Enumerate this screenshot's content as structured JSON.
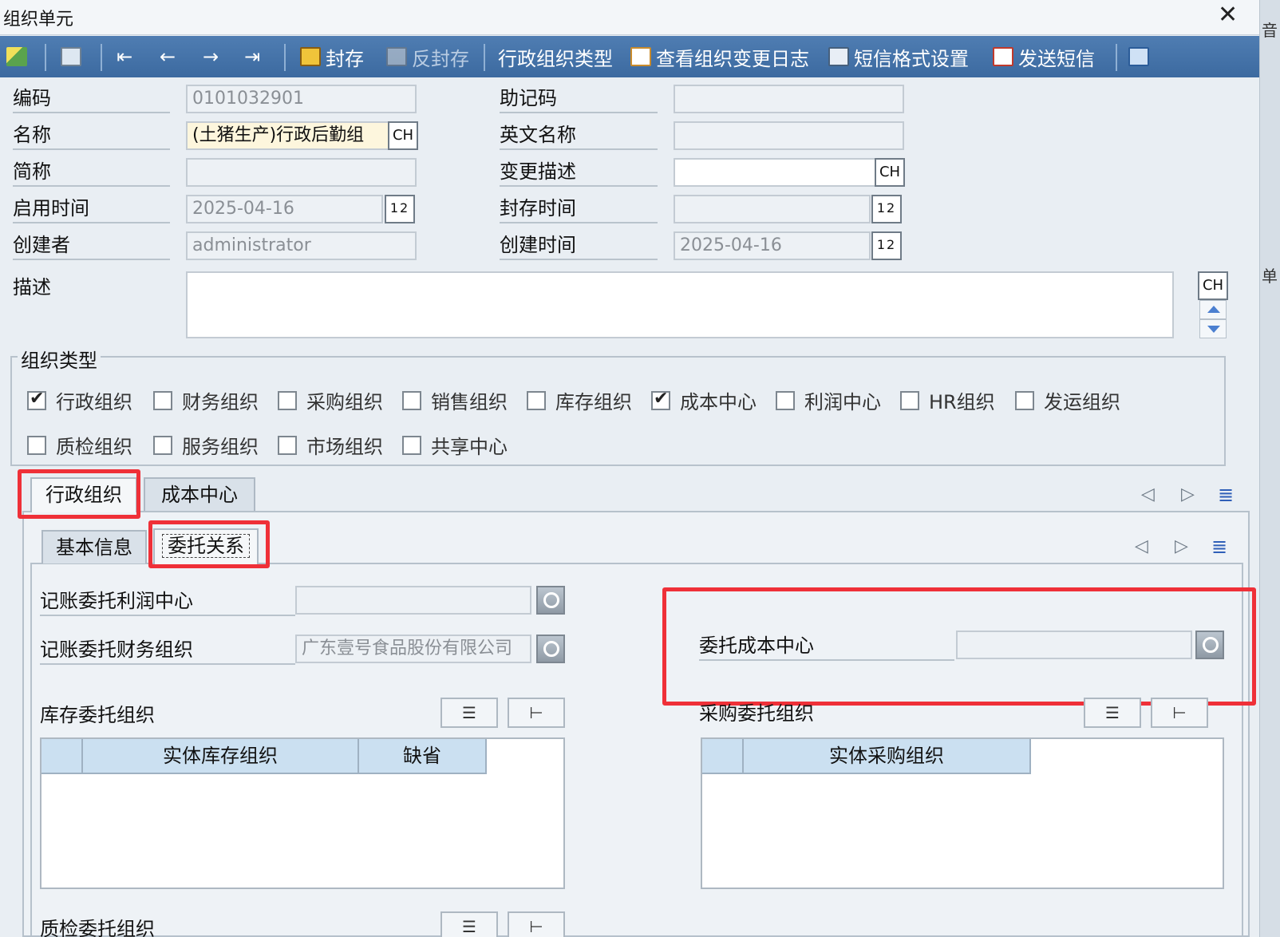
{
  "window": {
    "title": "组织单元",
    "close_label": "✕"
  },
  "right_fragments": {
    "top": "音",
    "mid": "单"
  },
  "toolbar": {
    "seal": "封存",
    "unseal": "反封存",
    "admin_org_type": "行政组织类型",
    "view_change_log": "查看组织变更日志",
    "sms_format": "短信格式设置",
    "send_sms": "发送短信"
  },
  "form": {
    "code": {
      "label": "编码",
      "value": "0101032901"
    },
    "mnemonic": {
      "label": "助记码",
      "value": ""
    },
    "name": {
      "label": "名称",
      "value": "(土猪生产)行政后勤组"
    },
    "english_name": {
      "label": "英文名称",
      "value": ""
    },
    "short_name": {
      "label": "简称",
      "value": ""
    },
    "change_desc": {
      "label": "变更描述",
      "value": ""
    },
    "enable_time": {
      "label": "启用时间",
      "value": "2025-04-16"
    },
    "seal_time": {
      "label": "封存时间",
      "value": ""
    },
    "creator": {
      "label": "创建者",
      "value": "administrator"
    },
    "create_time": {
      "label": "创建时间",
      "value": "2025-04-16"
    },
    "description": {
      "label": "描述",
      "value": ""
    },
    "lang_button": "CH",
    "calendar_button": "12"
  },
  "org_types": {
    "title": "组织类型",
    "items": [
      {
        "label": "行政组织",
        "checked": true
      },
      {
        "label": "财务组织",
        "checked": false
      },
      {
        "label": "采购组织",
        "checked": false
      },
      {
        "label": "销售组织",
        "checked": false
      },
      {
        "label": "库存组织",
        "checked": false
      },
      {
        "label": "成本中心",
        "checked": true
      },
      {
        "label": "利润中心",
        "checked": false
      },
      {
        "label": "HR组织",
        "checked": false
      },
      {
        "label": "发运组织",
        "checked": false
      },
      {
        "label": "质检组织",
        "checked": false
      },
      {
        "label": "服务组织",
        "checked": false
      },
      {
        "label": "市场组织",
        "checked": false
      },
      {
        "label": "共享中心",
        "checked": false
      }
    ]
  },
  "tabs": {
    "outer": [
      "行政组织",
      "成本中心"
    ],
    "inner": [
      "基本信息",
      "委托关系"
    ]
  },
  "delegation": {
    "profit_center": {
      "label": "记账委托利润中心",
      "value": ""
    },
    "finance_org": {
      "label": "记账委托财务组织",
      "value": "广东壹号食品股份有限公司"
    },
    "cost_center": {
      "label": "委托成本中心",
      "value": ""
    },
    "inventory": {
      "label": "库存委托组织",
      "columns": [
        "实体库存组织",
        "缺省"
      ]
    },
    "purchase": {
      "label": "采购委托组织",
      "columns": [
        "实体采购组织"
      ]
    },
    "quality": {
      "label": "质检委托组织"
    }
  }
}
